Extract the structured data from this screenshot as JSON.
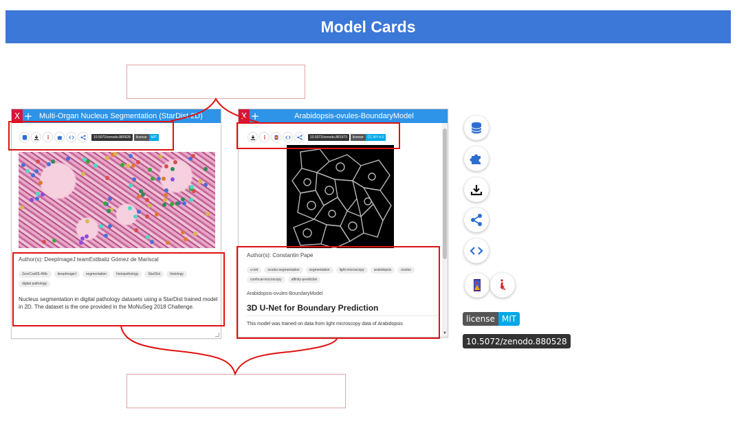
{
  "header": {
    "title": "Model Cards"
  },
  "card1": {
    "close_label": "X",
    "add_label": "+",
    "title": "Multi-Organ Nucleus Segmentation (StarDist 2D)",
    "doi": "10.5072/zenodo.880528",
    "license_label": "license",
    "license_value": "MIT",
    "authors": "Author(s): DeepImageJ teamEstibaliz Gómez de Mariscal",
    "tags": [
      "ZeroCostDL4Mic",
      "deepImageJ",
      "segmentation",
      "histopathology",
      "StarDist",
      "histology",
      "digital pathology"
    ],
    "description": "Nucleus segmentation in digital pathology datasets using a StarDist trained model in 2D. The dataset is the one provided in the MoNuSeg 2018 Challenge."
  },
  "card2": {
    "close_label": "X",
    "add_label": "+",
    "title": "Arabidopsis-ovules-BoundaryModel",
    "doi": "10.5072/zenodo.881973",
    "license_label": "license",
    "license_value": "CC-BY-4.0",
    "authors": "Author(s): Constantin Pape",
    "tags": [
      "u-net",
      "ovules-segmentation",
      "segmentation",
      "light-microscopy",
      "arabidopsis",
      "ovules",
      "confocal-microscopy",
      "affinity-prediction"
    ],
    "model_name": "Arabidopsis-ovules-BoundaryModel",
    "heading": "3D U-Net for Boundary Prediction",
    "description": "This model was trained on data from light microscopy data of Arabidopsis"
  },
  "legend": {
    "license_label": "license",
    "license_value": "MIT",
    "doi": "10.5072/zenodo.880528"
  },
  "icons": [
    "database-icon",
    "puzzle-icon",
    "download-icon",
    "share-icon",
    "code-icon",
    "imagej-icon",
    "ilastik-icon"
  ],
  "colors": {
    "header_bg": "#3b78d8",
    "card_title_bg": "#2d94e8",
    "close_bg": "#d6163a",
    "highlight": "#e01010",
    "license_value_bg": "#00a8e8"
  }
}
